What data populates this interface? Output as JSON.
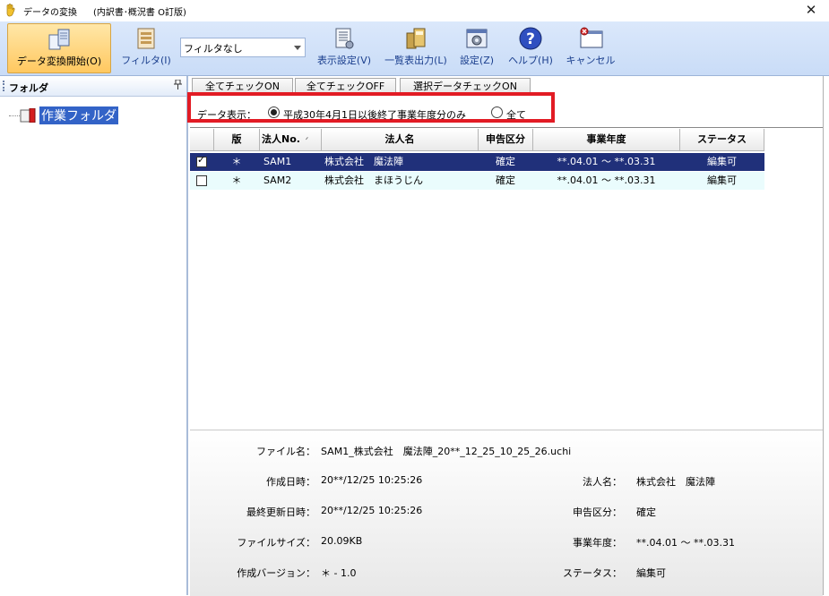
{
  "window": {
    "title": "データの変換",
    "subtitle": "(内訳書･概況書 O訂版)",
    "close_glyph": "✕"
  },
  "toolbar": {
    "convert_label": "データ変換開始(O)",
    "filter_label": "フィルタ(I)",
    "filter_select_value": "フィルタなし",
    "display_settings_label": "表示設定(V)",
    "list_output_label": "一覧表出力(L)",
    "settings_label": "設定(Z)",
    "help_label": "ヘルプ(H)",
    "cancel_label": "キャンセル"
  },
  "sidebar": {
    "title": "フォルダ",
    "pin_glyph": "ㅁ",
    "folder_label": "作業フォルダ"
  },
  "check_buttons": {
    "all_on": "全てチェックON",
    "all_off": "全てチェックOFF",
    "selected_on": "選択データチェックON"
  },
  "display_filter": {
    "label": "データ表示：",
    "option_fy30": "平成30年4月1日以後終了事業年度分のみ",
    "option_all": "全て",
    "selected": "fy30"
  },
  "grid": {
    "columns": [
      "版",
      "法人No.",
      "法人名",
      "申告区分",
      "事業年度",
      "ステータス"
    ],
    "sort_glyph": "ᐟ",
    "rows": [
      {
        "checked": true,
        "version": "＊",
        "corp_no": "SAM1",
        "corp_name": "株式会社　魔法陣",
        "category": "確定",
        "fiscal_year": "**.04.01 ～ **.03.31",
        "status": "編集可"
      },
      {
        "checked": false,
        "version": "＊",
        "corp_no": "SAM2",
        "corp_name": "株式会社　まほうじん",
        "category": "確定",
        "fiscal_year": "**.04.01 ～ **.03.31",
        "status": "編集可"
      }
    ]
  },
  "details": {
    "file_name_label": "ファイル名：",
    "file_name": "SAM1_株式会社　魔法陣_20**_12_25_10_25_26.uchi",
    "created_label": "作成日時：",
    "created": "20**/12/25 10:25:26",
    "modified_label": "最終更新日時：",
    "modified": "20**/12/25 10:25:26",
    "size_label": "ファイルサイズ：",
    "size": "20.09KB",
    "version_label": "作成バージョン：",
    "version": "＊ - 1.0",
    "corp_name_label": "法人名：",
    "corp_name": "株式会社　魔法陣",
    "category_label": "申告区分：",
    "category": "確定",
    "fiscal_year_label": "事業年度：",
    "fiscal_year": "**.04.01 ～ **.03.31",
    "status_label": "ステータス：",
    "status": "編集可"
  },
  "colors": {
    "highlight_border": "#e21b24",
    "selected_row": "#20307a",
    "alt_row": "#eafcfd",
    "toolbar_text": "#1b3f8e"
  }
}
